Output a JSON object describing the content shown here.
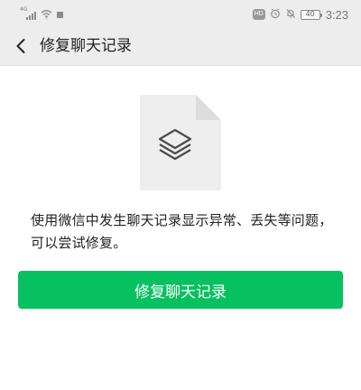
{
  "status_bar": {
    "network_label": "4G",
    "battery_level": "40",
    "time": "3:23",
    "hd_label": "HD",
    "colors": {
      "background": "#ededed",
      "icons": "#8a8a8a"
    }
  },
  "header": {
    "title": "修复聊天记录",
    "back_icon": "chevron-left-icon",
    "background": "#ededed"
  },
  "main": {
    "doc_icon": "document-stack-icon",
    "description": "使用微信中发生聊天记录显示异常、丢失等问题，可以尝试修复。",
    "primary_button": {
      "label": "修复聊天记录",
      "color": "#07c160"
    }
  }
}
